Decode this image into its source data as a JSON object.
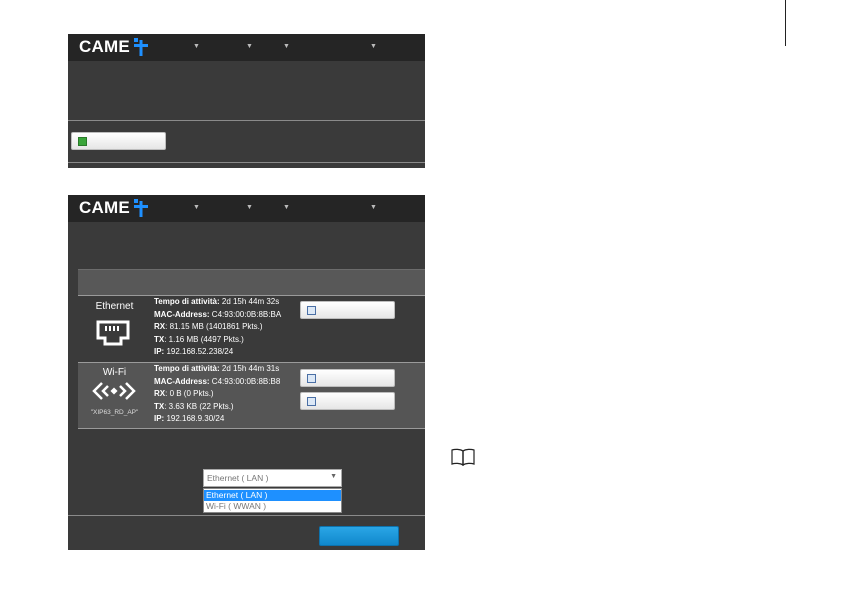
{
  "brand": {
    "name": "CAME",
    "color": "#1e90ff"
  },
  "ethernet": {
    "label": "Ethernet",
    "icon": "ethernet-port-icon",
    "lines": [
      {
        "key": "Tempo di attività:",
        "value": " 2d 15h 44m 32s"
      },
      {
        "key": "MAC-Address:",
        "value": " C4:93:00:0B:8B:BA"
      },
      {
        "key": "RX",
        "value": ": 81.15 MB (1401861 Pkts.)"
      },
      {
        "key": "TX",
        "value": ": 1.16 MB (4497 Pkts.)"
      },
      {
        "key": "IP:",
        "value": " 192.168.52.238/24"
      }
    ]
  },
  "wifi": {
    "label": "Wi-Fi",
    "icon": "wifi-diamonds-icon",
    "ssid": "\"XIP63_RD_AP\"",
    "lines": [
      {
        "key": "Tempo di attività:",
        "value": " 2d 15h 44m 31s"
      },
      {
        "key": "MAC-Address:",
        "value": " C4:93:00:0B:8B:B8"
      },
      {
        "key": "RX",
        "value": ": 0 B (0 Pkts.)"
      },
      {
        "key": "TX",
        "value": ": 3.63 KB (22 Pkts.)"
      },
      {
        "key": "IP:",
        "value": " 192.168.9.30/24"
      }
    ]
  },
  "dropdown": {
    "selected": "Ethernet ( LAN )",
    "options": [
      "Ethernet ( LAN )",
      "Wi-Fi ( WWAN )"
    ]
  },
  "icons": {
    "manual": "book-icon"
  }
}
